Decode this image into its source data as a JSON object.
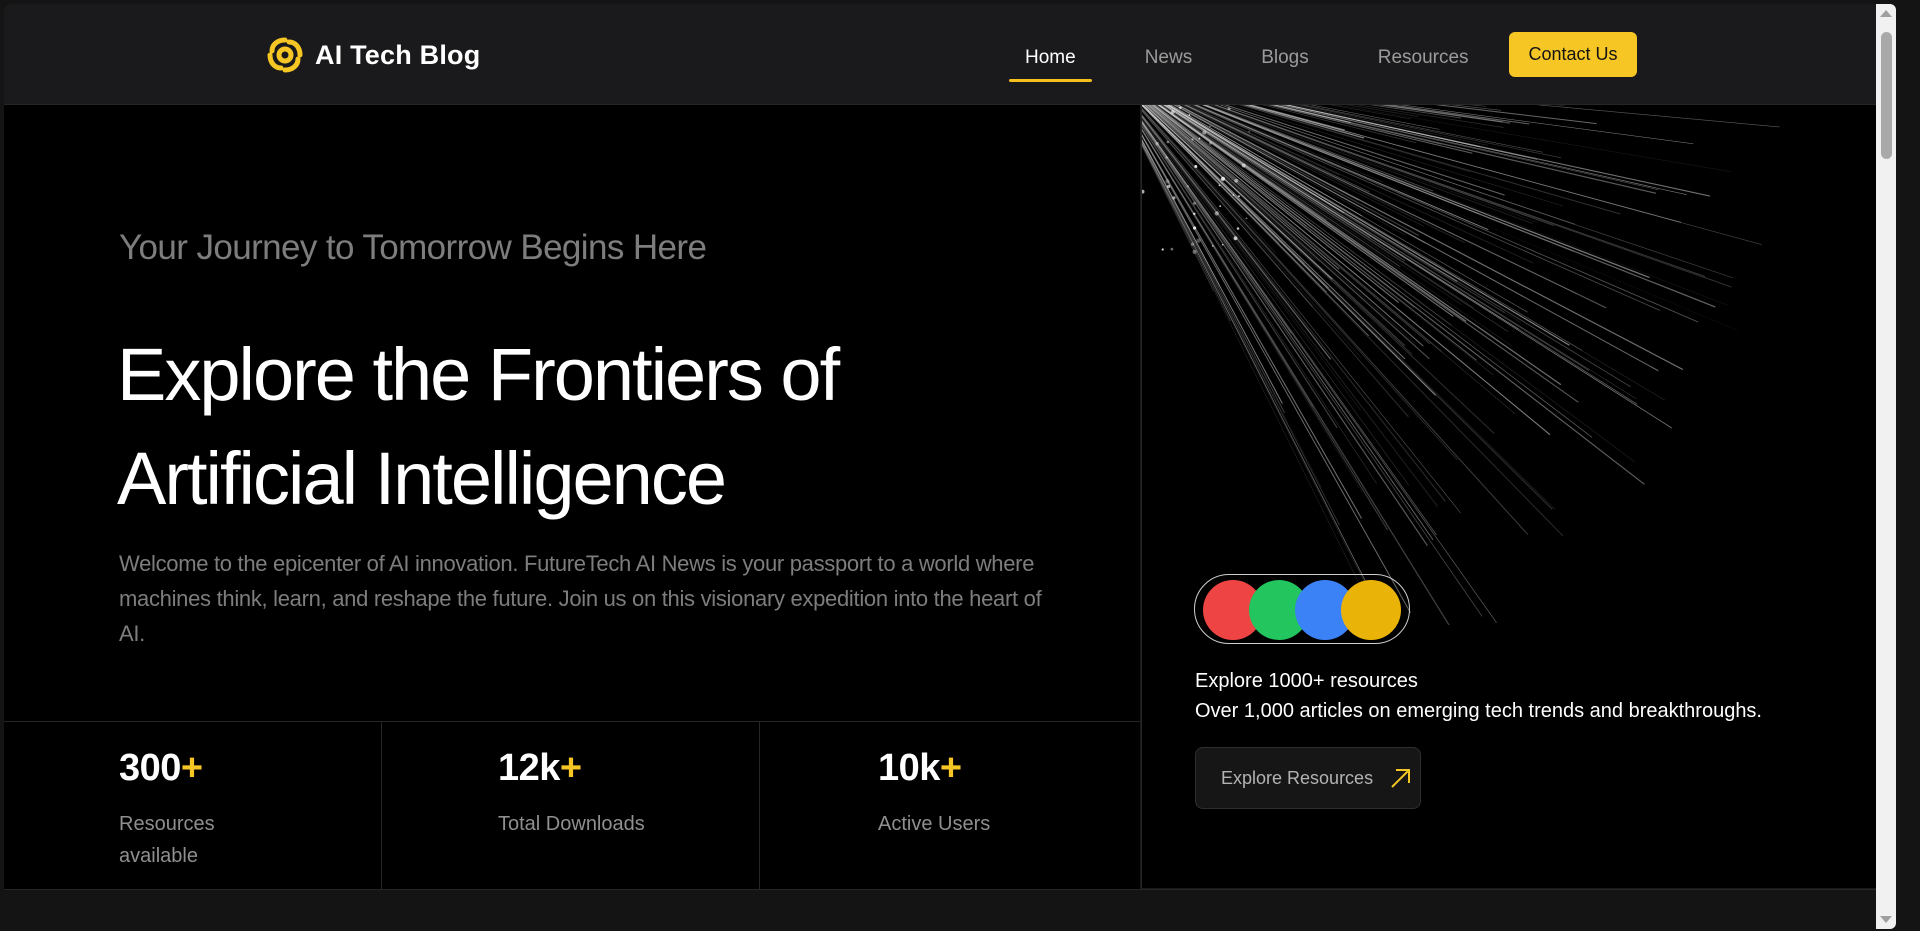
{
  "header": {
    "brand_name": "AI Tech Blog",
    "logo_icon": "yellow-swirl-logo-icon",
    "accent_color": "#F6C624",
    "nav": [
      {
        "label": "Home",
        "active": true
      },
      {
        "label": "News",
        "active": false
      },
      {
        "label": "Blogs",
        "active": false
      },
      {
        "label": "Resources",
        "active": false
      }
    ],
    "contact_label": "Contact Us"
  },
  "hero": {
    "tagline": "Your Journey to Tomorrow Begins Here",
    "headline_line1": "Explore the Frontiers of",
    "headline_line2": "Artificial Intelligence",
    "description": "Welcome to the epicenter of AI innovation. FutureTech AI News is your passport to a world where machines think, learn, and reshape the future. Join us on this visionary expedition into the heart of AI."
  },
  "stats": [
    {
      "value": "300",
      "suffix": "+",
      "label": "Resources available"
    },
    {
      "value": "12k",
      "suffix": "+",
      "label": "Total Downloads"
    },
    {
      "value": "10k",
      "suffix": "+",
      "label": "Active Users"
    }
  ],
  "resources_card": {
    "avatar_colors": [
      "#EF4444",
      "#22C55E",
      "#3B82F6",
      "#EAB308"
    ],
    "title": "Explore 1000+ resources",
    "subtitle": "Over 1,000 articles on emerging tech trends and breakthroughs.",
    "button_label": "Explore Resources",
    "button_icon": "arrow-up-right-icon"
  }
}
